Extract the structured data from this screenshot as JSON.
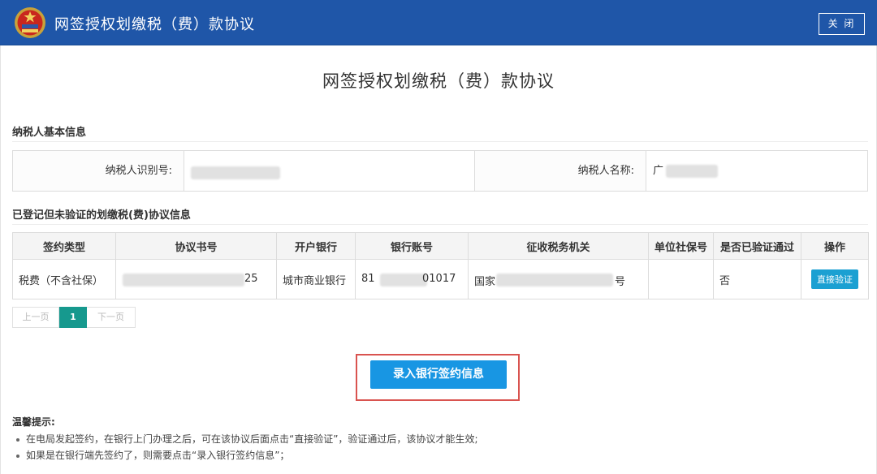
{
  "window": {
    "title": "网签授权划缴税（费）款协议",
    "close_label": "关 闭",
    "header_color": "#1f56a8"
  },
  "page": {
    "heading": "网签授权划缴税（费）款协议"
  },
  "taxpayer": {
    "section_title": "纳税人基本信息",
    "id_label": "纳税人识别号:",
    "name_label": "纳税人名称:",
    "name_value_visible": "广"
  },
  "agreements": {
    "section_title": "已登记但未验证的划缴税(费)协议信息",
    "columns": [
      "签约类型",
      "协议书号",
      "开户银行",
      "银行账号",
      "征收税务机关",
      "单位社保号",
      "是否已验证通过",
      "操作"
    ],
    "rows": [
      {
        "type": "税费（不含社保）",
        "agreement_no_visible_tail": "25",
        "bank": "城市商业银行",
        "account_head": "81",
        "account_tail": "01017",
        "tax_office_head": "国家",
        "tax_office_tail": "号",
        "social_security_no": "",
        "verified": "否",
        "action": "直接验证"
      }
    ]
  },
  "pagination": {
    "prev": "上一页",
    "current": "1",
    "next": "下一页"
  },
  "primary_action": {
    "label": "录入银行签约信息",
    "color": "#1896e3",
    "highlight_color": "#d9534f"
  },
  "tips": {
    "title": "温馨提示:",
    "items": [
      "在电局发起签约，在银行上门办理之后，可在该协议后面点击“直接验证”，验证通过后，该协议才能生效;",
      "如果是在银行端先签约了，则需要点击“录入银行签约信息”；"
    ]
  }
}
